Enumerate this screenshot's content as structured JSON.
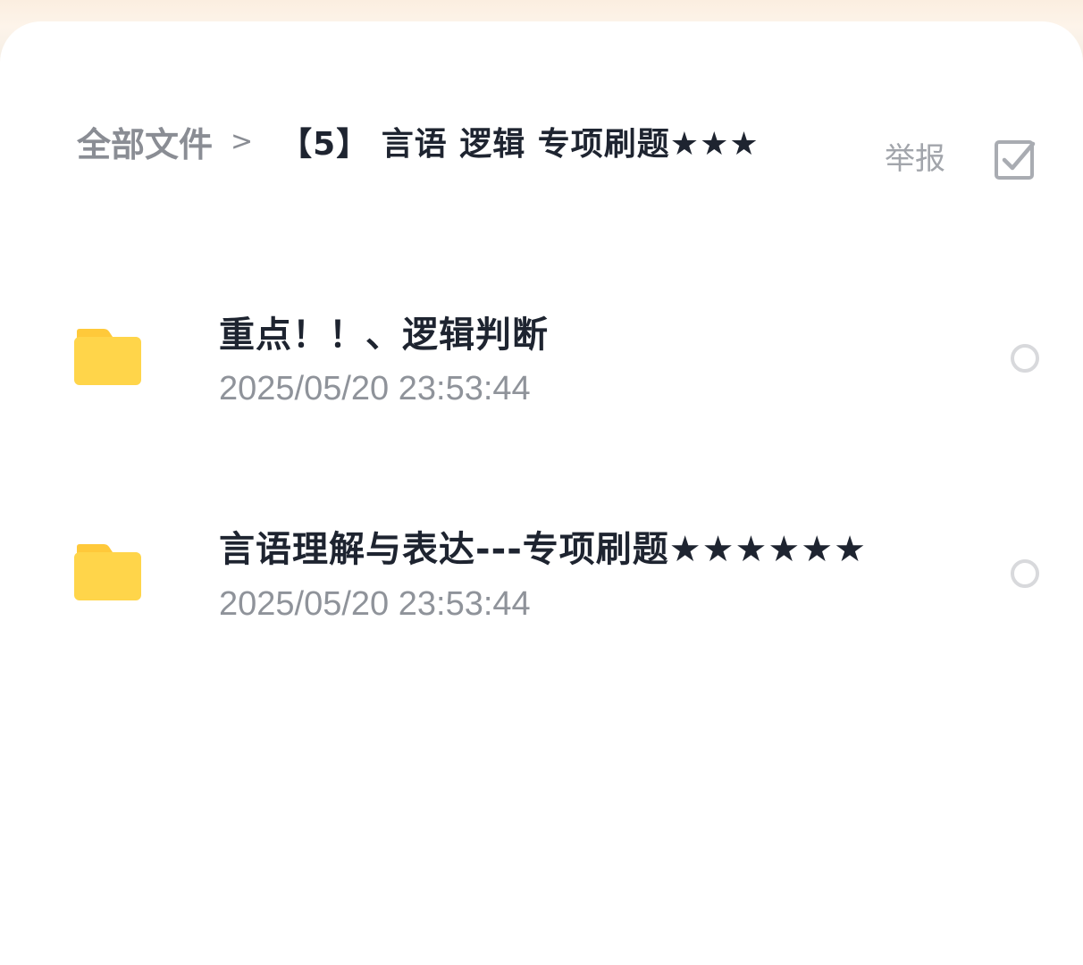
{
  "breadcrumb": {
    "root": "全部文件",
    "separator": ">",
    "current": "【5】 言语 逻辑 专项刷题★★★"
  },
  "header": {
    "report_label": "举报",
    "select_icon": "checkbox-check-icon"
  },
  "files": [
    {
      "icon": "folder-icon",
      "name": "重点！！、逻辑判断",
      "date": "2025/05/20 23:53:44"
    },
    {
      "icon": "folder-icon",
      "name": "言语理解与表达---专项刷题★★★★★★",
      "date": "2025/05/20 23:53:44"
    }
  ],
  "colors": {
    "folder": "#ffd54a",
    "folder_tab": "#ffc93a",
    "title_text": "#1e2430",
    "muted_text": "#8f939a",
    "radio_border": "#d8d9dc"
  }
}
